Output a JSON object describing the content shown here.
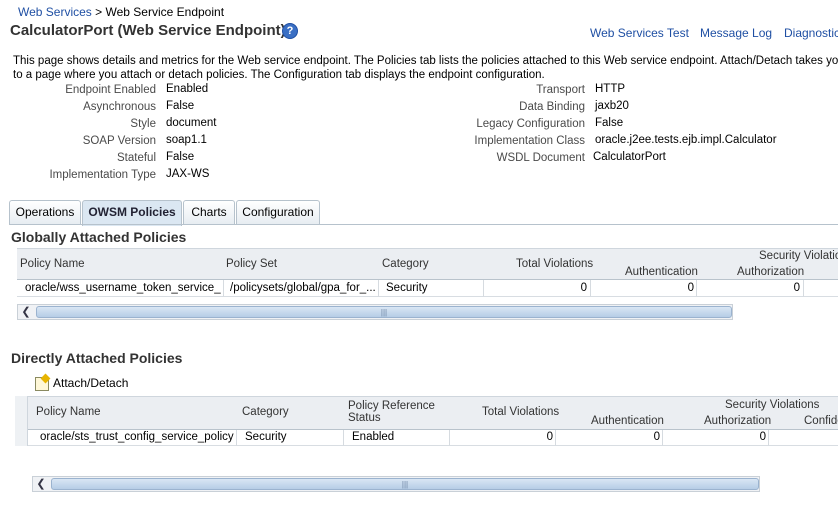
{
  "breadcrumb": {
    "root": "Web Services",
    "separator": ">",
    "current": "Web Service Endpoint"
  },
  "title": "CalculatorPort (Web Service Endpoint)",
  "top_links": [
    "Web Services Test",
    "Message Log",
    "Diagnostic L"
  ],
  "description": "This page shows details and metrics for the Web service endpoint. The Policies tab lists the policies attached to this Web service endpoint. Attach/Detach takes you to a page where you attach or detach policies. The Configuration tab displays the endpoint configuration.",
  "properties_left": [
    {
      "label": "Endpoint Enabled",
      "value": "Enabled"
    },
    {
      "label": "Asynchronous",
      "value": "False"
    },
    {
      "label": "Style",
      "value": "document"
    },
    {
      "label": "SOAP Version",
      "value": "soap1.1"
    },
    {
      "label": "Stateful",
      "value": "False"
    },
    {
      "label": "Implementation Type",
      "value": "JAX-WS"
    }
  ],
  "properties_right": [
    {
      "label": "Transport",
      "value": "HTTP"
    },
    {
      "label": "Data Binding",
      "value": "jaxb20"
    },
    {
      "label": "Legacy Configuration",
      "value": "False"
    },
    {
      "label": "Implementation Class",
      "value": "oracle.j2ee.tests.ejb.impl.Calculator"
    },
    {
      "label": "WSDL Document",
      "value": "CalculatorPort"
    }
  ],
  "tabs": [
    "Operations",
    "OWSM Policies",
    "Charts",
    "Configuration"
  ],
  "active_tab": "OWSM Policies",
  "global_section": {
    "title": "Globally Attached Policies",
    "headers": {
      "policy_name": "Policy Name",
      "policy_set": "Policy Set",
      "category": "Category",
      "total_violations": "Total Violations",
      "security_group": "Security Violatio",
      "authentication": "Authentication",
      "authorization": "Authorization"
    },
    "row": {
      "policy_name": "oracle/wss_username_token_service_...",
      "policy_set": "/policysets/global/gpa_for_...",
      "category": "Security",
      "total_violations": "0",
      "authentication": "0",
      "authorization": "0"
    }
  },
  "direct_section": {
    "title": "Directly Attached Policies",
    "toolbar_label": "Attach/Detach",
    "headers": {
      "policy_name": "Policy Name",
      "category": "Category",
      "ref_status_1": "Policy Reference",
      "ref_status_2": "Status",
      "total_violations": "Total Violations",
      "security_group": "Security Violations",
      "authentication": "Authentication",
      "authorization": "Authorization",
      "confidentiality": "Confide"
    },
    "row": {
      "policy_name": "oracle/sts_trust_config_service_policy",
      "category": "Security",
      "status": "Enabled",
      "total_violations": "0",
      "authentication": "0",
      "authorization": "0"
    }
  },
  "scroll_grip": "|||"
}
